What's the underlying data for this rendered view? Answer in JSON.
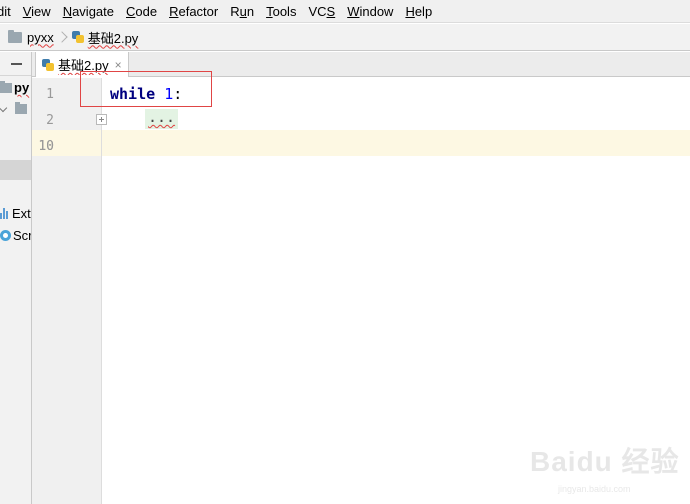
{
  "menu": {
    "items": [
      {
        "pre": "",
        "u": "",
        "post": "dit"
      },
      {
        "pre": "",
        "u": "V",
        "post": "iew"
      },
      {
        "pre": "",
        "u": "N",
        "post": "avigate"
      },
      {
        "pre": "",
        "u": "C",
        "post": "ode"
      },
      {
        "pre": "",
        "u": "R",
        "post": "efactor"
      },
      {
        "pre": "R",
        "u": "u",
        "post": "n"
      },
      {
        "pre": "",
        "u": "T",
        "post": "ools"
      },
      {
        "pre": "VC",
        "u": "S",
        "post": ""
      },
      {
        "pre": "",
        "u": "W",
        "post": "indow"
      },
      {
        "pre": "",
        "u": "H",
        "post": "elp"
      }
    ]
  },
  "breadcrumb": {
    "project": "pyxx",
    "file": "基础2.py"
  },
  "project_panel": {
    "root_label": "py",
    "tool_items": [
      "Ext",
      "Scr"
    ]
  },
  "editor": {
    "tab_label": "基础2.py",
    "tab_close": "×",
    "line_numbers": [
      "1",
      "2",
      "10"
    ],
    "line1_keyword": "while",
    "line1_number": "1",
    "line1_colon": ":",
    "folded_text": "..."
  },
  "watermark": {
    "brand": "Baidu 经验",
    "sub": "jingyan.baidu.com"
  },
  "colors": {
    "keyword": "#000080",
    "number": "#0000ff",
    "caret_line": "#fdf8e3",
    "highlight_box": "#e04545"
  }
}
